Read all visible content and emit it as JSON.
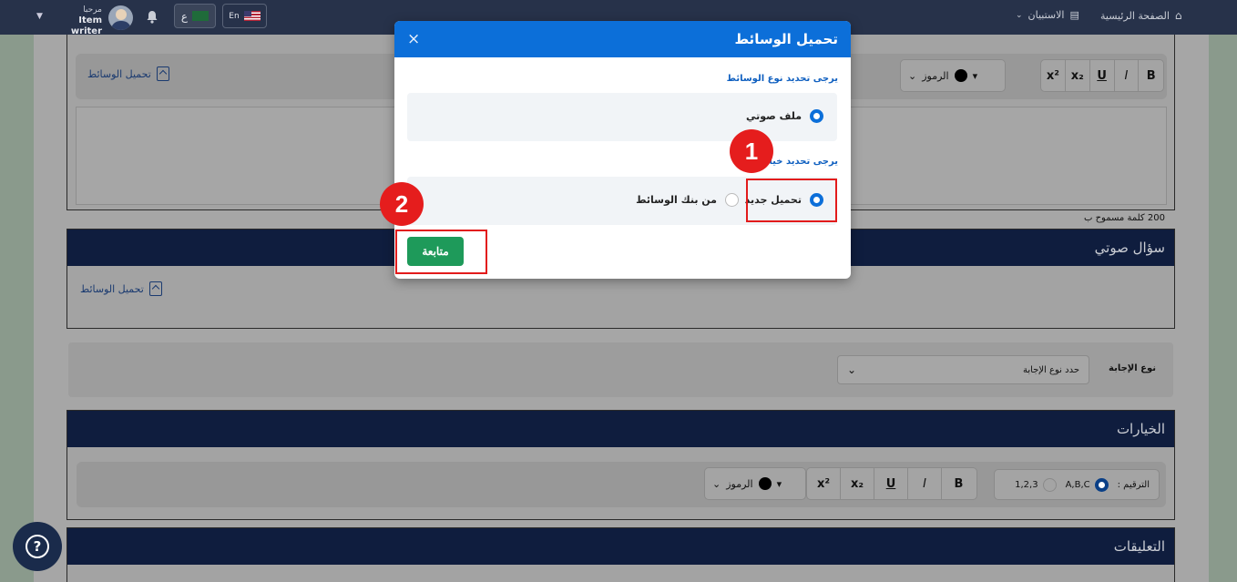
{
  "topbar": {
    "greeting": "مرحبا",
    "user_name": "Item writer",
    "lang_ar": "ع",
    "lang_en": "En",
    "home": "الصفحة الرئيسية",
    "surveys": "الاستبيان"
  },
  "editor1": {
    "upload_label": "تحميل الوسائط",
    "symbols_label": "الرموز",
    "word_limit": "200 كلمة مسموح ب"
  },
  "audio_question": {
    "title": "سؤال صوتي",
    "upload_label": "تحميل الوسائط"
  },
  "answer_type": {
    "label": "نوع الإجابة",
    "select_placeholder": "حدد نوع الإجابة"
  },
  "choices": {
    "title": "الخيارات",
    "numbering_label": "الترقيم :",
    "numbering_options": [
      "A,B,C",
      "1,2,3"
    ],
    "symbols_label": "الرموز"
  },
  "comments": {
    "title": "التعليقات"
  },
  "format_buttons": {
    "bold": "B",
    "italic": "I",
    "underline": "U",
    "subscript": "x₂",
    "superscript": "x²"
  },
  "modal": {
    "title": "تحميل الوسائط",
    "close": "×",
    "media_type_prompt": "يرجى تحديد نوع الوسائط",
    "media_type_option": "ملف صوتي",
    "choice_prompt": "يرجى تحديد خيار",
    "choice_options": [
      "تحميل جديد",
      "من بنك الوسائط"
    ],
    "continue_label": "متابعة"
  },
  "annotations": {
    "step1": "1",
    "step2": "2"
  },
  "colors": {
    "modal_header": "#0c6fd9",
    "continue_button": "#1e9a5a",
    "highlight": "#e21b1b",
    "navbar": "#27324a",
    "card_header": "#0f1d3e"
  }
}
